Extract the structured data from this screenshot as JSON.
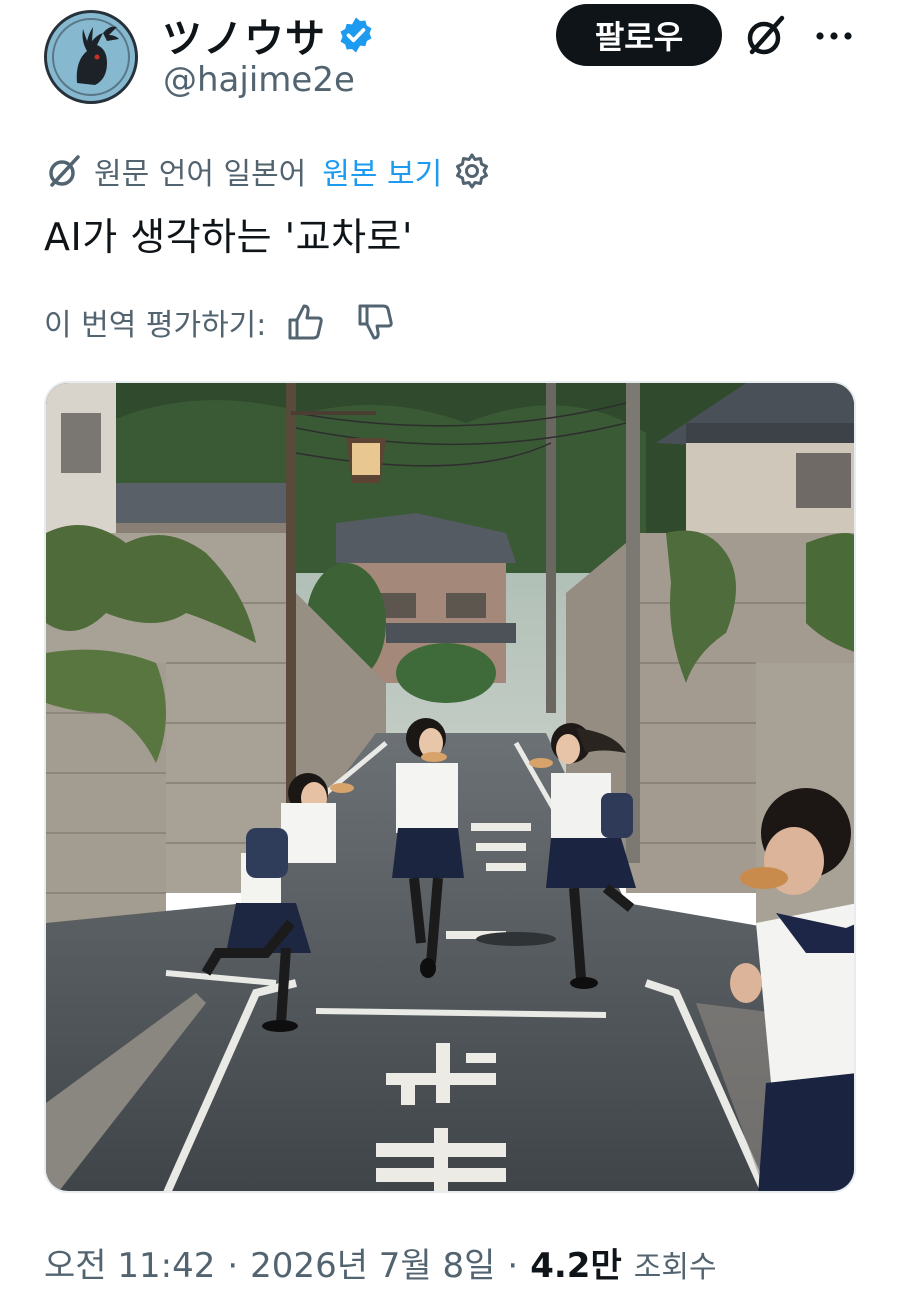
{
  "author": {
    "display_name": "ツノウサ",
    "handle": "@hajime2e",
    "verified": true,
    "avatar_icon": "horned-rabbit-avatar"
  },
  "actions": {
    "follow_label": "팔로우",
    "grok_icon": "grok-icon",
    "more_icon": "more-icon"
  },
  "translation": {
    "source_label": "원문 언어 일본어",
    "show_original_label": "원본 보기",
    "settings_icon": "gear-icon"
  },
  "post": {
    "text": "AI가 생각하는 '교차로'",
    "rate_label": "이 번역 평가하기:"
  },
  "media": {
    "type": "photo"
  },
  "footer": {
    "time": "오전 11:42",
    "date": "2026년 7월 8일",
    "separator": "·",
    "views_count": "4.2만",
    "views_label": "조회수"
  },
  "colors": {
    "text": "#0f1419",
    "secondary": "#536471",
    "link": "#1d9bf0",
    "verified": "#1d9bf0",
    "button_bg": "#0f1419"
  }
}
